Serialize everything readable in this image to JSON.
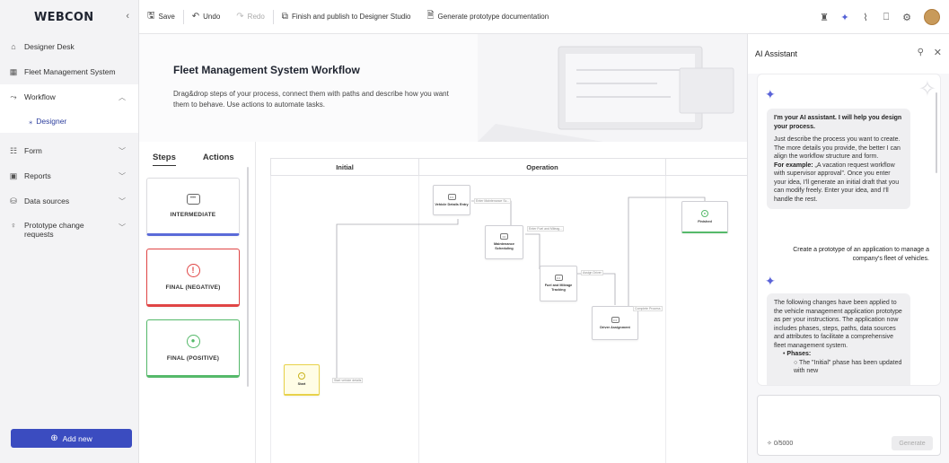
{
  "sidebar": {
    "logo": "WEBCON",
    "collapse_icon": "‹",
    "items": [
      {
        "label": "Designer Desk",
        "icon": "home-icon"
      },
      {
        "label": "Fleet Management System",
        "icon": "grid-icon"
      },
      {
        "label": "Workflow",
        "icon": "workflow-icon"
      },
      {
        "label": "Designer",
        "icon": "designer-icon"
      },
      {
        "label": "Form",
        "icon": "form-icon"
      },
      {
        "label": "Reports",
        "icon": "reports-icon"
      },
      {
        "label": "Data sources",
        "icon": "database-icon"
      },
      {
        "label": "Prototype change requests",
        "icon": "lightbulb-icon"
      }
    ],
    "add_new": "Add new"
  },
  "toolbar": {
    "save": "Save",
    "undo": "Undo",
    "redo": "Redo",
    "publish": "Finish and publish to Designer Studio",
    "docs": "Generate prototype documentation"
  },
  "banner": {
    "title": "Fleet Management System Workflow",
    "description": "Drag&drop steps of your process, connect them with paths and describe how you want them to behave. Use actions to automate tasks."
  },
  "steps_panel": {
    "tabs": [
      "Steps",
      "Actions"
    ],
    "cards": [
      {
        "title": "INTERMEDIATE",
        "icon": "intermediate-icon",
        "icon_glyph": "•••"
      },
      {
        "title": "FINAL (NEGATIVE)",
        "icon": "negative-icon",
        "icon_glyph": "!"
      },
      {
        "title": "FINAL (POSITIVE)",
        "icon": "positive-icon",
        "icon_glyph": "●"
      }
    ]
  },
  "canvas": {
    "phases": [
      "Initial",
      "Operation"
    ],
    "nodes": [
      {
        "label": "Start",
        "glyph": "+"
      },
      {
        "label": "Vehicle Details Entry",
        "glyph": "•••"
      },
      {
        "label": "Maintenance Scheduling",
        "glyph": "•••"
      },
      {
        "label": "Fuel and Mileage Tracking",
        "glyph": "•••"
      },
      {
        "label": "Driver Assignment",
        "glyph": "•••"
      },
      {
        "label": "Finished",
        "glyph": "●"
      }
    ],
    "paths": [
      "Start vehicle details",
      "Enter Maintenance Sc...",
      "Enter Fuel and Mileag...",
      "Assign Driver",
      "Complete Process"
    ]
  },
  "ai_assistant": {
    "title": "AI Assistant",
    "intro_bold": "I'm your AI assistant. I will help you design your process.",
    "intro_text": "Just describe the process you want to create. The more details you provide, the better I can align the workflow structure and form.",
    "example_label": "For example:",
    "example_text": " „A vacation request workflow with supervisor approval”. Once you enter your idea, I'll generate an initial draft that you can modify freely. Enter your idea, and I'll handle the rest.",
    "user_message": "Create a prototype of an application to manage a company's fleet of vehicles.",
    "response_text": "The following changes have been applied to the vehicle management application prototype as per your instructions. The application now includes phases, steps, paths, data sources and attributes to facilitate a comprehensive fleet management system.",
    "bullet_phases": "Phases:",
    "bullet_sub": "The \"Initial\" phase has been updated with new",
    "counter": "0/5000",
    "generate": "Generate"
  },
  "colors": {
    "accent": "#3b4cc0",
    "negative": "#e04545",
    "positive": "#55b96a",
    "start": "#e8d24a"
  }
}
